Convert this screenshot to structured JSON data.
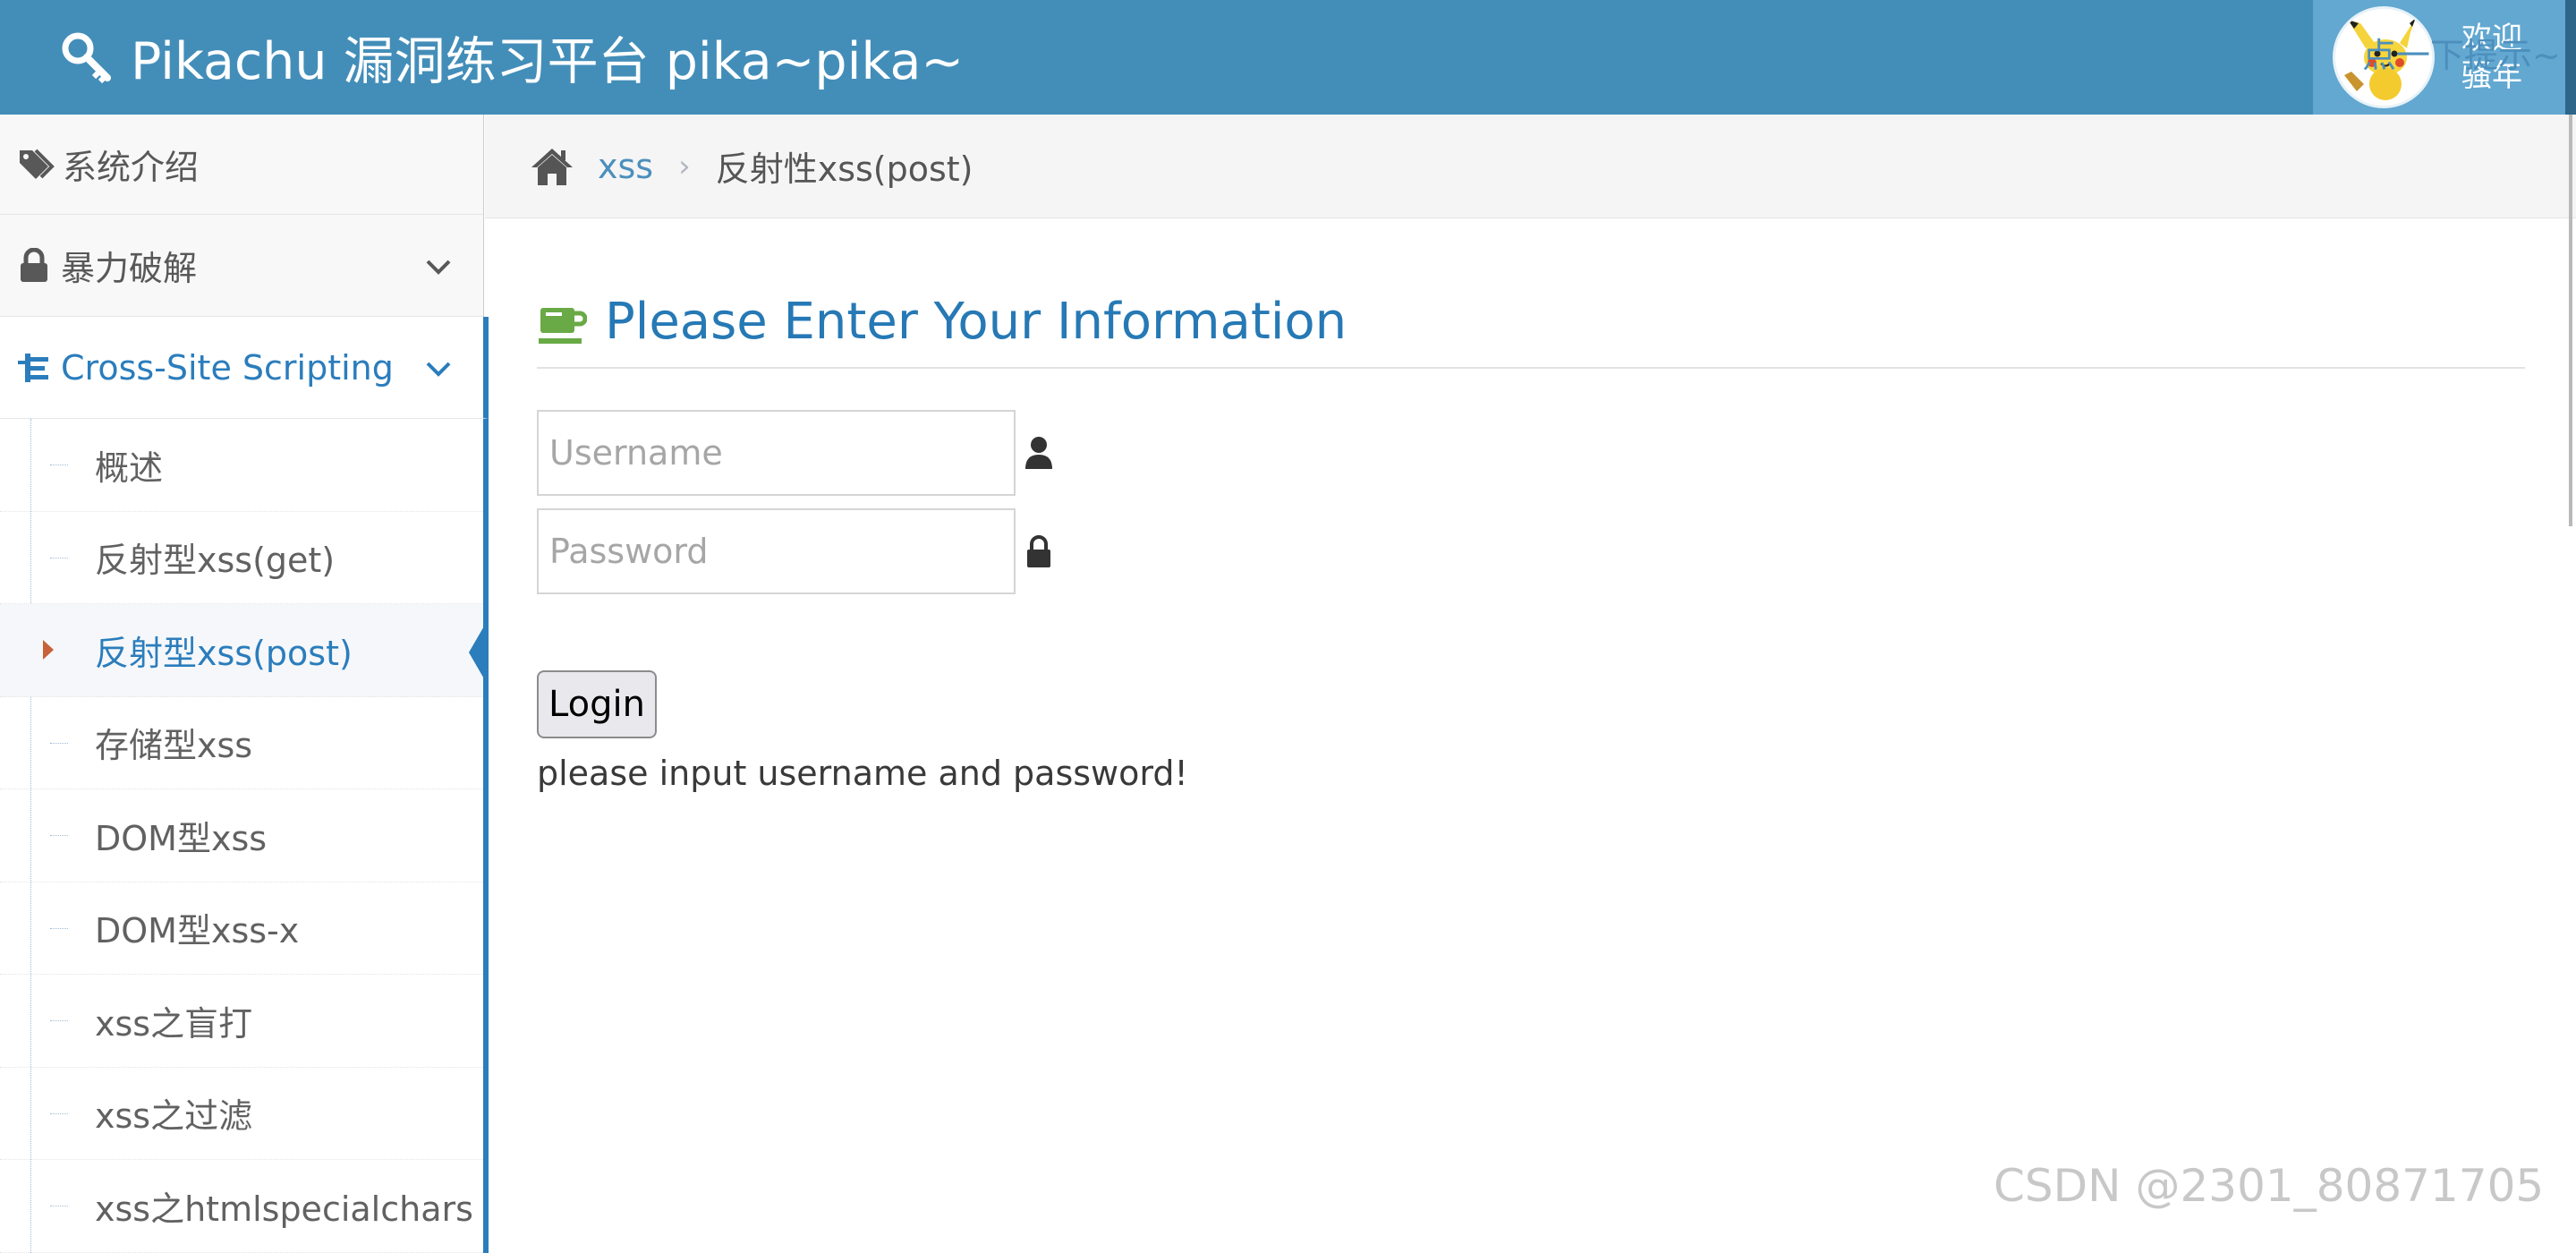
{
  "header": {
    "brand": "Pikachu 漏洞练习平台 pika~pika~",
    "welcome_line1": "欢迎",
    "welcome_line2": "骚年"
  },
  "sidebar": {
    "intro": "系统介绍",
    "groups": [
      {
        "label": "暴力破解",
        "icon": "lock-icon",
        "expanded": false
      },
      {
        "label": "Cross-Site Scripting",
        "icon": "sitemap-icon",
        "expanded": true
      }
    ],
    "submenu": [
      {
        "label": "概述"
      },
      {
        "label": "反射型xss(get)"
      },
      {
        "label": "反射型xss(post)",
        "active": true
      },
      {
        "label": "存储型xss"
      },
      {
        "label": "DOM型xss"
      },
      {
        "label": "DOM型xss-x"
      },
      {
        "label": "xss之盲打"
      },
      {
        "label": "xss之过滤"
      },
      {
        "label": "xss之htmlspecialchars"
      }
    ]
  },
  "breadcrumbs": {
    "link": "xss",
    "separator": "›",
    "current": "反射性xss(post)",
    "hint": "点一下提示~"
  },
  "main": {
    "title": "Please Enter Your Information",
    "username_placeholder": "Username",
    "password_placeholder": "Password",
    "login_label": "Login",
    "message": "please input username and password!"
  },
  "watermark": "CSDN @2301_80871705",
  "colors": {
    "navbar": "#438eb9",
    "accent": "#2b7dbc",
    "title": "#2679b5",
    "cup": "#69aa46"
  }
}
